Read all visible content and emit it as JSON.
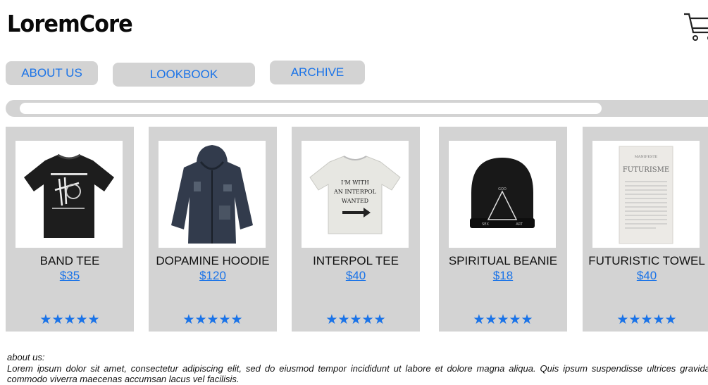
{
  "brand": {
    "logo": "LoremCore"
  },
  "header": {
    "cart_icon": "cart-icon"
  },
  "nav": [
    {
      "label": "ABOUT US"
    },
    {
      "label": "LOOKBOOK"
    },
    {
      "label": "ARCHIVE"
    }
  ],
  "products": [
    {
      "name": "BAND TEE",
      "price": "$35",
      "rating": "★★★★★",
      "icon": "band-tee-image"
    },
    {
      "name": "DOPAMINE HOODIE",
      "price": "$120",
      "rating": "★★★★★",
      "icon": "hoodie-image"
    },
    {
      "name": "INTERPOL TEE",
      "price": "$40",
      "rating": "★★★★★",
      "icon": "interpol-tee-image",
      "shirt_text": "I'M WITH AN INTERPOL WANTED"
    },
    {
      "name": "SPIRITUAL BEANIE",
      "price": "$18",
      "rating": "★★★★★",
      "icon": "beanie-image"
    },
    {
      "name": "FUTURISTIC TOWEL",
      "price": "$40",
      "rating": "★★★★★",
      "icon": "towel-image",
      "towel_title": "FUTURISME"
    }
  ],
  "about": {
    "heading": "about us:",
    "text": "Lorem ipsum dolor sit amet, consectetur adipiscing elit, sed do eiusmod tempor incididunt ut labore et dolore magna aliqua. Quis ipsum suspendisse ultrices gravida. Risus commodo viverra maecenas accumsan lacus vel facilisis."
  },
  "colors": {
    "accent": "#1a73e8",
    "card_bg": "#d3d3d3"
  }
}
